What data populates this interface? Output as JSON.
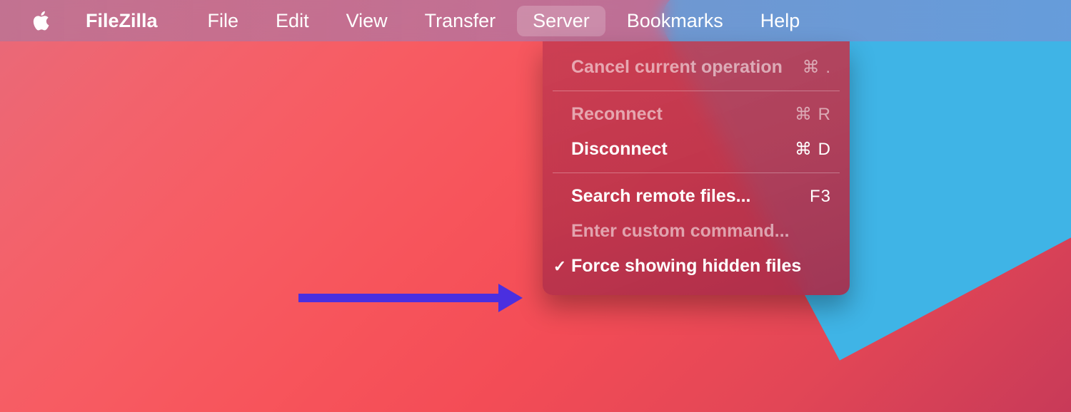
{
  "menubar": {
    "app_name": "FileZilla",
    "items": [
      {
        "label": "File"
      },
      {
        "label": "Edit"
      },
      {
        "label": "View"
      },
      {
        "label": "Transfer"
      },
      {
        "label": "Server"
      },
      {
        "label": "Bookmarks"
      },
      {
        "label": "Help"
      }
    ],
    "active_index": 4
  },
  "dropdown": {
    "items": [
      {
        "label": "Cancel current operation",
        "shortcut": "⌘ .",
        "enabled": false,
        "checked": false,
        "separator_after": true
      },
      {
        "label": "Reconnect",
        "shortcut": "⌘ R",
        "enabled": false,
        "checked": false
      },
      {
        "label": "Disconnect",
        "shortcut": "⌘ D",
        "enabled": true,
        "checked": false,
        "separator_after": true
      },
      {
        "label": "Search remote files...",
        "shortcut": "F3",
        "enabled": true,
        "checked": false
      },
      {
        "label": "Enter custom command...",
        "shortcut": "",
        "enabled": false,
        "checked": false
      },
      {
        "label": "Force showing hidden files",
        "shortcut": "",
        "enabled": true,
        "checked": true
      }
    ]
  },
  "annotation": {
    "arrow_color": "#4a2fe0"
  }
}
